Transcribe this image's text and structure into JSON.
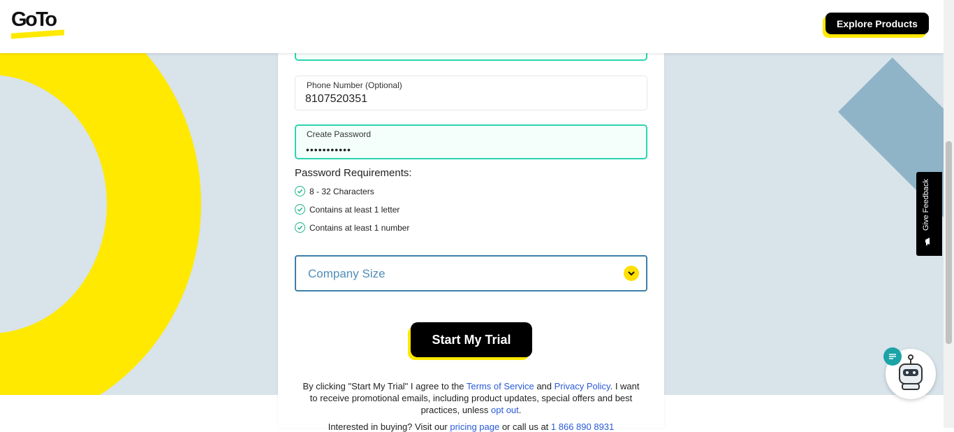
{
  "header": {
    "logo_text": "GoTo",
    "explore_label": "Explore Products"
  },
  "form": {
    "phone": {
      "label": "Phone Number (Optional)",
      "value": "8107520351"
    },
    "password": {
      "label": "Create Password",
      "value": "•••••••••••"
    },
    "requirements_title": "Password Requirements:",
    "requirements": [
      "8 - 32 Characters",
      "Contains at least 1 letter",
      "Contains at least 1 number"
    ],
    "company_size_placeholder": "Company Size",
    "submit_label": "Start My Trial"
  },
  "legal": {
    "part1": "By clicking \"Start My Trial\" I agree to the ",
    "terms": "Terms of Service",
    "and": " and ",
    "privacy": "Privacy Policy",
    "part2": ". I want to receive promotional emails, including product updates, special offers and best practices, unless ",
    "opt_out": "opt out",
    "part3": ".",
    "line2_pre": "Interested in buying? Visit our ",
    "pricing": "pricing page",
    "line2_mid": " or call us at ",
    "phone": "1 866 890 8931"
  },
  "widgets": {
    "feedback_label": "Give Feedback"
  },
  "colors": {
    "brand_yellow": "#ffe900",
    "valid_green": "#2dd4b0",
    "link_blue": "#2a5bd7",
    "select_blue": "#3d7fa8"
  }
}
